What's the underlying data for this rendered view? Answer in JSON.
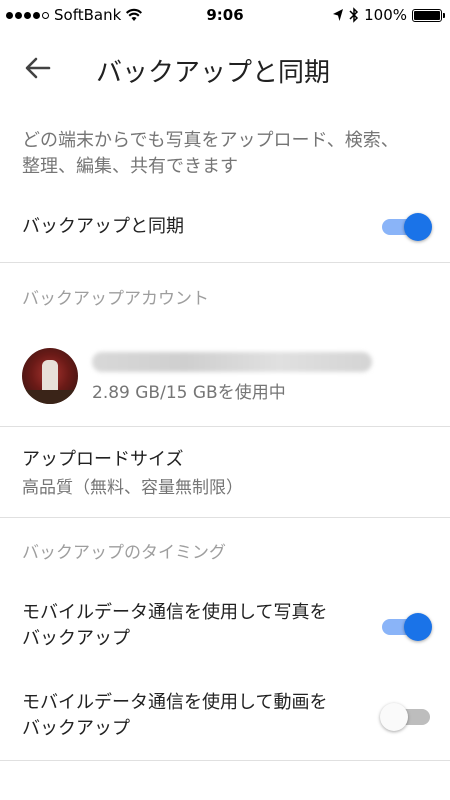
{
  "status_bar": {
    "carrier": "SoftBank",
    "time": "9:06",
    "battery": "100%"
  },
  "app_bar": {
    "title": "バックアップと同期"
  },
  "description": "どの端末からでも写真をアップロード、検索、整理、編集、共有できます",
  "backup_sync": {
    "label": "バックアップと同期",
    "enabled": true
  },
  "backup_account": {
    "header": "バックアップアカウント",
    "usage": "2.89 GB/15 GBを使用中"
  },
  "upload_size": {
    "label": "アップロードサイズ",
    "value": "高品質（無料、容量無制限）"
  },
  "timing": {
    "header": "バックアップのタイミング",
    "photos": {
      "label_line1": "モバイルデータ通信を使用して写真を",
      "label_line2": "バックアップ",
      "enabled": true
    },
    "videos": {
      "label_line1": "モバイルデータ通信を使用して動画を",
      "label_line2": "バックアップ",
      "enabled": false
    }
  },
  "colors": {
    "accent": "#1a73e8",
    "accent_track": "#8ab4f8"
  }
}
